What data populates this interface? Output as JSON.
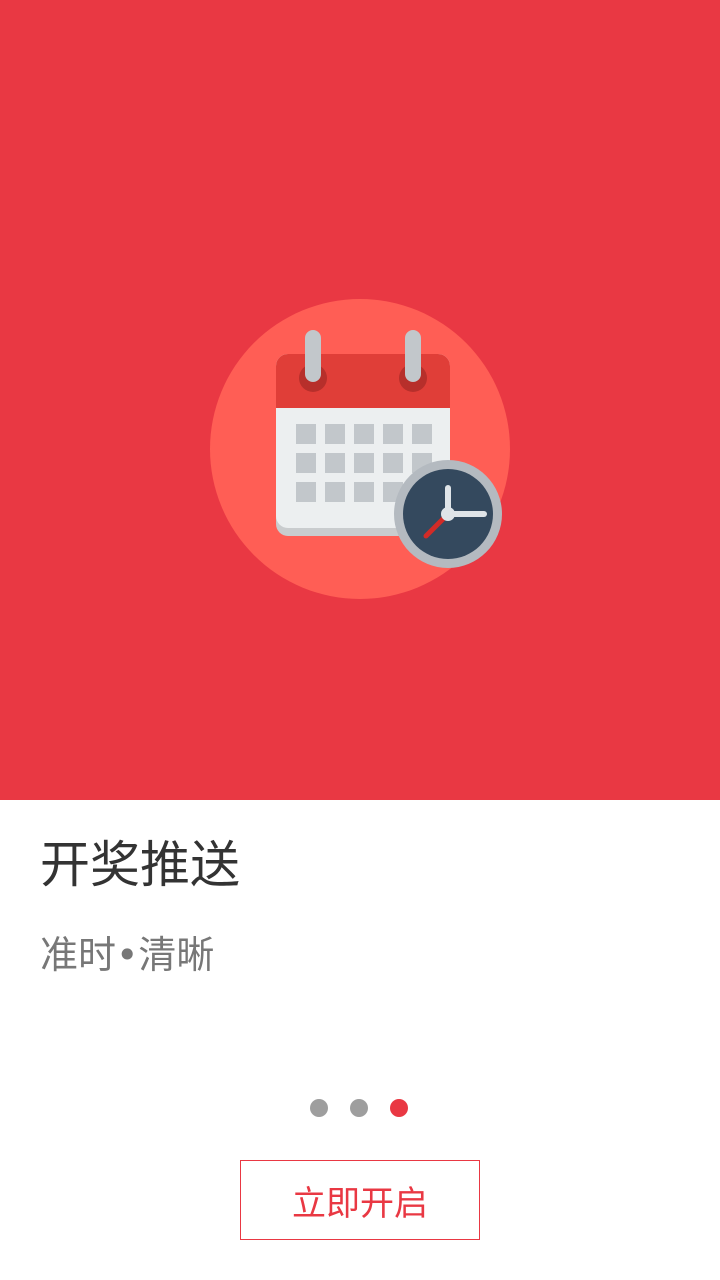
{
  "onboarding": {
    "title": "开奖推送",
    "subtitle": "准时•清晰",
    "cta_label": "立即开启",
    "page_count": 3,
    "active_page": 3,
    "illustration_icon": "calendar-clock-icon"
  },
  "colors": {
    "hero_background": "#e93843",
    "illustration_circle": "#ff5e55",
    "accent": "#e93843",
    "dot_inactive": "#9e9e9e",
    "dot_active": "#e93843",
    "title_text": "#333333",
    "subtitle_text": "#777777"
  }
}
